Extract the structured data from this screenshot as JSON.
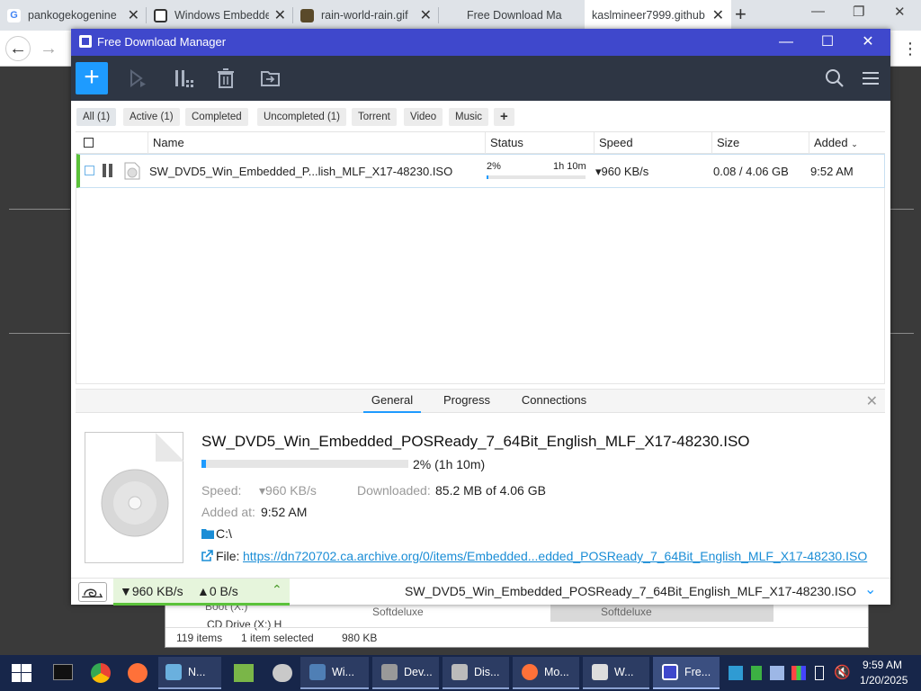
{
  "browser": {
    "tabs": [
      {
        "title": "pankogekogenine",
        "favicon": "google-icon",
        "close": "✕"
      },
      {
        "title": "Windows Embedde",
        "favicon": "archive-icon",
        "close": "✕"
      },
      {
        "title": "rain-world-rain.gif",
        "favicon": "image-icon",
        "close": "✕"
      },
      {
        "title": "Free Download Ma",
        "favicon": "blank-icon",
        "close": ""
      },
      {
        "title": "kaslmineer7999.github",
        "favicon": "blank-icon",
        "close": "✕",
        "active": true
      }
    ],
    "new_tab": "+"
  },
  "fdm": {
    "title": "Free Download Manager",
    "accent": "#1e9bff",
    "titlebar_color": "#3f48cc",
    "filters": [
      "All (1)",
      "Active (1)",
      "Completed",
      "Uncompleted (1)",
      "Torrent",
      "Video",
      "Music",
      "+"
    ],
    "columns": {
      "name": "Name",
      "status": "Status",
      "speed": "Speed",
      "size": "Size",
      "added": "Added"
    },
    "download": {
      "name": "SW_DVD5_Win_Embedded_P...lish_MLF_X17-48230.ISO",
      "percent": "2%",
      "progress": 0.02,
      "eta": "1h 10m",
      "speed": "▾960 KB/s",
      "size": "0.08 / 4.06 GB",
      "added": "9:52 AM"
    },
    "details": {
      "tabs": [
        "General",
        "Progress",
        "Connections"
      ],
      "filename": "SW_DVD5_Win_Embedded_POSReady_7_64Bit_English_MLF_X17-48230.ISO",
      "progress_text": "2% (1h 10m)",
      "speed_label": "Speed:",
      "speed_value": "▾960 KB/s",
      "downloaded_label": "Downloaded:",
      "downloaded_value": "85.2 MB of 4.06 GB",
      "added_label": "Added at:",
      "added_value": "9:52 AM",
      "folder": "C:\\",
      "file_label": "File:",
      "file_url": "https://dn720702.ca.archive.org/0/items/Embedded...edded_POSReady_7_64Bit_English_MLF_X17-48230.ISO"
    },
    "status": {
      "down": "▼960 KB/s",
      "up": "▲0 B/s",
      "current_file": "SW_DVD5_Win_Embedded_POSReady_7_64Bit_English_MLF_X17-48230.ISO"
    }
  },
  "explorer": {
    "items": "119 items",
    "selected": "1 item selected",
    "size": "980 KB",
    "row1": "Softdeluxe",
    "row2": "Softdeluxe",
    "drive": "CD Drive (X:) H",
    "boot": "Boot (X:)"
  },
  "taskbar": {
    "items": [
      {
        "label": "N...",
        "icon": "notepad-icon"
      },
      {
        "label": "Wi...",
        "icon": "computer-icon"
      },
      {
        "label": "Dev...",
        "icon": "device-icon"
      },
      {
        "label": "Dis...",
        "icon": "disk-icon"
      },
      {
        "label": "Mo...",
        "icon": "firefox-icon"
      },
      {
        "label": "W...",
        "icon": "drive-icon"
      },
      {
        "label": "Fre...",
        "icon": "fdm-icon"
      }
    ],
    "time": "9:59 AM",
    "date": "1/20/2025"
  }
}
